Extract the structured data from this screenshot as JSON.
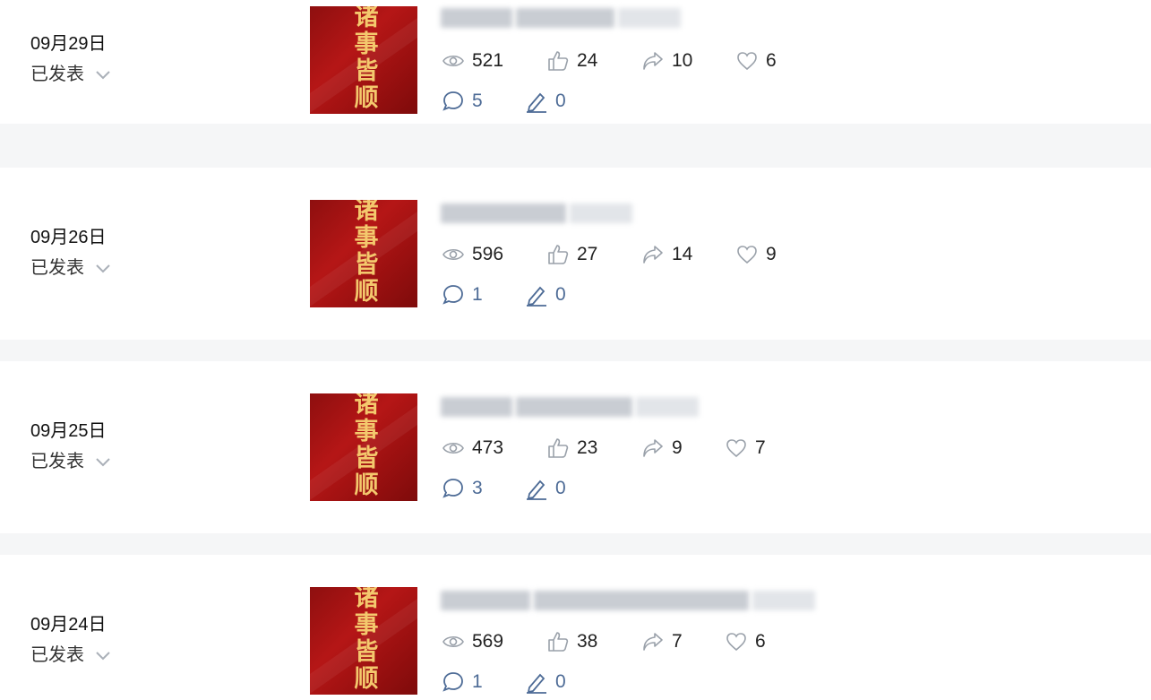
{
  "posts": [
    {
      "date": "09月29日",
      "status": "已发表",
      "views": "521",
      "likes": "24",
      "shares": "10",
      "favorites": "6",
      "comments": "5",
      "edits": "0",
      "thumb_text": "诸事皆顺"
    },
    {
      "date": "09月26日",
      "status": "已发表",
      "views": "596",
      "likes": "27",
      "shares": "14",
      "favorites": "9",
      "comments": "1",
      "edits": "0",
      "thumb_text": "诸事皆顺"
    },
    {
      "date": "09月25日",
      "status": "已发表",
      "views": "473",
      "likes": "23",
      "shares": "9",
      "favorites": "7",
      "comments": "3",
      "edits": "0",
      "thumb_text": "诸事皆顺"
    },
    {
      "date": "09月24日",
      "status": "已发表",
      "views": "569",
      "likes": "38",
      "shares": "7",
      "favorites": "6",
      "comments": "1",
      "edits": "0",
      "thumb_text": "诸事皆顺"
    }
  ],
  "icons": {
    "views": "eye-icon",
    "likes": "thumbs-up-icon",
    "shares": "share-icon",
    "favorites": "heart-icon",
    "comments": "comment-icon",
    "edits": "pen-icon",
    "status": "chevron-down-icon"
  },
  "colors": {
    "background": "#f5f6f7",
    "card": "#ffffff",
    "accent_blue": "#4d6b96",
    "thumb_red": "#b51616",
    "thumb_gold": "#f4c86d"
  }
}
